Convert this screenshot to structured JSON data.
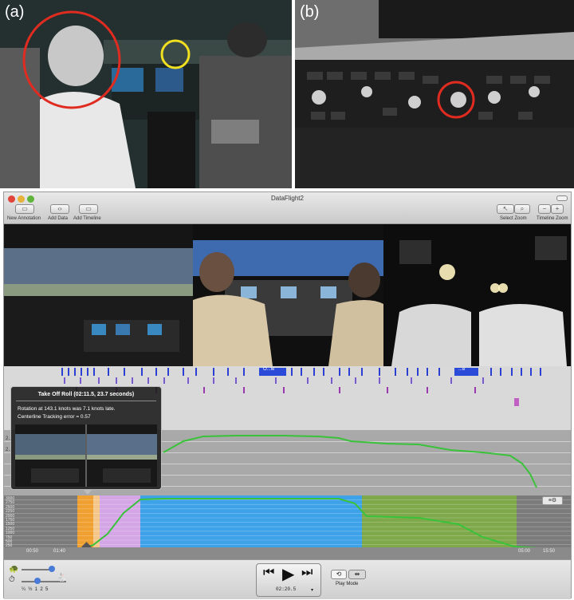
{
  "figure": {
    "panel_a_label": "(a)",
    "panel_b_label": "(b)"
  },
  "window": {
    "title": "DataFlight2"
  },
  "toolbar": {
    "new_annotation": "New Annotation",
    "add_data": "Add Data",
    "add_timeline": "Add Timeline",
    "select_zoom": "Select  Zoom",
    "timeline_zoom": "Timeline Zoom"
  },
  "track_labels": {
    "label_1": "O...le",
    "label_2": "...e"
  },
  "popup": {
    "title": "Take Off Roll (02:11.5, 23.7 seconds)",
    "line1": "Rotation at 143.1 knots was 7.1 knots late.",
    "line2": "Centerline Tracking error = 0.57"
  },
  "timeline": {
    "y_ticks": [
      "3000",
      "2750",
      "2500",
      "2250",
      "2000",
      "1750",
      "1500",
      "1250",
      "1000",
      "750",
      "500",
      "250"
    ],
    "x_ticks": [
      "00:50",
      "01:40",
      "05:00",
      "15:50"
    ]
  },
  "graph": {
    "y_ticks": [
      "2...",
      "2..."
    ]
  },
  "playback": {
    "speed_ticks": "¼  ½  1  2  5",
    "time": "02:20.5",
    "play_mode_label": "Play Mode"
  },
  "colors": {
    "annotation_orange": "#f0a030",
    "segment_violet": "#d4a6e6",
    "segment_blue": "#3ea2e8",
    "segment_green": "#7ea84a",
    "data_line": "#39c23a",
    "highlight_red": "#e02c20",
    "highlight_yellow": "#f0e020"
  }
}
